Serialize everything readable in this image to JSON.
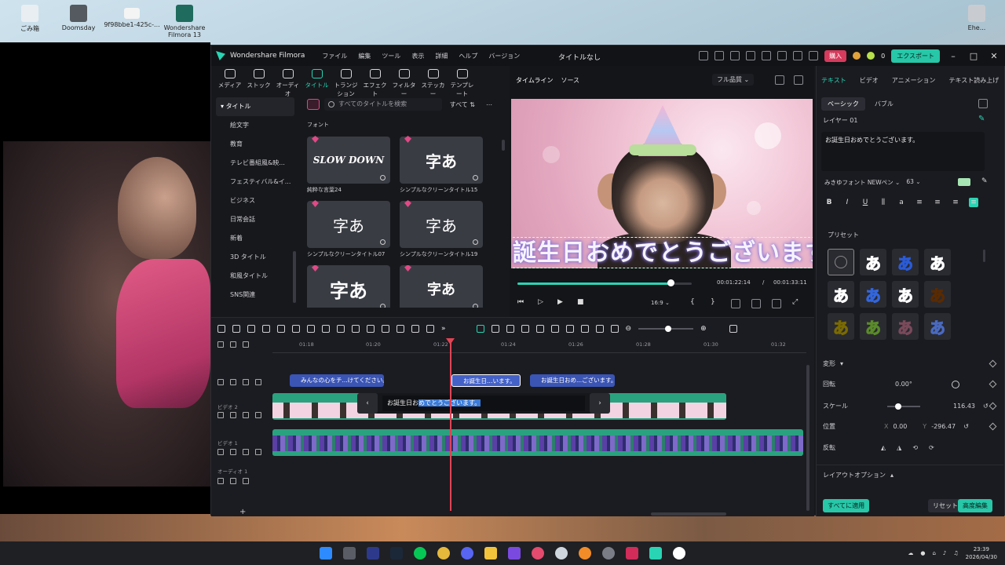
{
  "desktop": {
    "icons": [
      {
        "label": "ごみ箱",
        "color": "#e9eef2"
      },
      {
        "label": "Doomsday",
        "color": "#555a60"
      },
      {
        "label": "9f98bbe1-425c-...",
        "color": "#f4f4f4"
      },
      {
        "label": "Wondershare Filmora 13",
        "color": "#1f6b5d"
      },
      {
        "label": "Ehe...",
        "color": "#c8ccd0"
      }
    ]
  },
  "app": {
    "name": "Wondershare Filmora",
    "menu": [
      "ファイル",
      "編集",
      "ツール",
      "表示",
      "詳細",
      "ヘルプ",
      "バージョン"
    ],
    "doc_title": "タイトルなし",
    "buy_label": "購入",
    "credits": "0",
    "export_label": "エクスポート"
  },
  "toolbar": [
    {
      "label": "メディア",
      "active": false
    },
    {
      "label": "ストック",
      "active": false
    },
    {
      "label": "オーディオ",
      "active": false
    },
    {
      "label": "タイトル",
      "active": true
    },
    {
      "label": "トランジション",
      "active": false
    },
    {
      "label": "エフェクト",
      "active": false
    },
    {
      "label": "フィルター",
      "active": false
    },
    {
      "label": "ステッカー",
      "active": false
    },
    {
      "label": "テンプレート",
      "active": false
    }
  ],
  "sidebar": {
    "head": "タイトル",
    "items": [
      "絵文字",
      "教育",
      "テレビ番組風&映...",
      "フェスティバル&イ...",
      "ビジネス",
      "日常会話",
      "新着",
      "3D タイトル",
      "和風タイトル",
      "SNS関連"
    ]
  },
  "browser": {
    "search_placeholder": "すべてのタイトルを検索",
    "filter_label": "すべて",
    "section_label": "フォント",
    "cards": [
      {
        "thumb": "SLOW DOWN",
        "caption": "純粋な言葉24"
      },
      {
        "thumb": "字あ",
        "caption": "シンプルなクリーンタイトル15"
      },
      {
        "thumb": "字あ",
        "caption": "シンプルなクリーンタイトル07"
      },
      {
        "thumb": "字あ",
        "caption": "シンプルなクリーンタイトル19"
      },
      {
        "thumb": "字あ",
        "caption": ""
      },
      {
        "thumb": "字あ",
        "caption": ""
      }
    ]
  },
  "preview": {
    "tabs": [
      "タイムライン",
      "ソース"
    ],
    "quality": "フル品質",
    "caption_text": "誕生日おめでとうございます",
    "current_time": "00:01:22:14",
    "total_time": "00:01:33:11",
    "progress": 0.88,
    "ratio": "16:9"
  },
  "right_panel": {
    "tabs": [
      "テキスト",
      "ビデオ",
      "アニメーション",
      "テキスト読み上げ"
    ],
    "subtabs": [
      "ベーシック",
      "バブル"
    ],
    "layer_label": "レイヤー 01",
    "text_value": "お誕生日おめでとうございます。",
    "font": "みきゆフォント NEWペン",
    "font_size": "63",
    "preset_label": "プリセット",
    "presets": [
      "",
      "あ",
      "あ",
      "あ",
      "あ",
      "あ",
      "あ",
      "あ",
      "あ",
      "あ",
      "あ",
      "あ"
    ],
    "transform_label": "変形",
    "rotate_label": "回転",
    "rotate_value": "0.00°",
    "scale_label": "スケール",
    "scale_value": "116.43",
    "position_label": "位置",
    "pos_x_label": "X",
    "pos_x": "0.00",
    "pos_y_label": "Y",
    "pos_y": "-296.47",
    "flip_label": "反転",
    "layout_label": "レイアウトオプション",
    "apply_all": "すべてに適用",
    "reset": "リセット",
    "advanced": "高度編集"
  },
  "timeline": {
    "ruler": [
      "01:18",
      "01:20",
      "01:22",
      "01:24",
      "01:26",
      "01:28",
      "01:30",
      "01:32"
    ],
    "tracks": {
      "video2": "ビデオ 2",
      "video1": "ビデオ 1",
      "audio1": "オーディオ 1"
    },
    "title_clips": [
      "みんなの心をチ...けてください。",
      "お誕生日…います。",
      "お誕生日おめ...ございます。"
    ],
    "popup_text_plain": "お誕生日お",
    "popup_text_selected": "めでとうございます。"
  },
  "taskbar": {
    "time": "23:39",
    "date": "2026/04/30"
  }
}
